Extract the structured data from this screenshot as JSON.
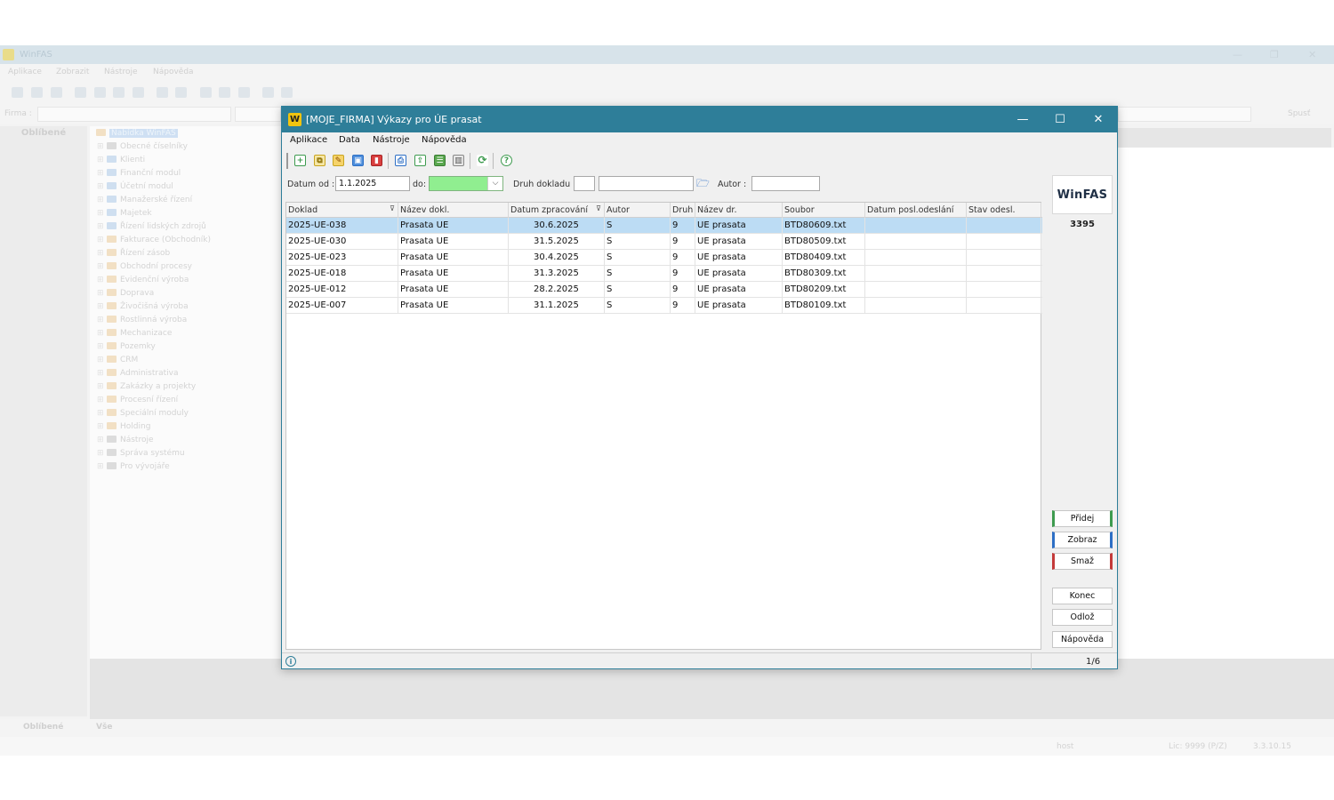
{
  "background_app": {
    "title": "WinFAS",
    "menu": [
      "Aplikace",
      "Zobrazit",
      "Nástroje",
      "Nápověda"
    ],
    "firma_label": "Firma :",
    "spust_label": "Spusť",
    "favorites_header": "Oblíbené",
    "tree_root": "Nabídka WinFAS",
    "tree_items": [
      "Obecné číselníky",
      "Klienti",
      "Finanční modul",
      "Účetní modul",
      "Manažerské řízení",
      "Majetek",
      "Řízení lidských zdrojů",
      "Fakturace (Obchodník)",
      "Řízení zásob",
      "Obchodní procesy",
      "Evidenční výroba",
      "Doprava",
      "Živočišná výroba",
      "Rostlinná výroba",
      "Mechanizace",
      "Pozemky",
      "CRM",
      "Administrativa",
      "Zakázky a projekty",
      "Procesní řízení",
      "Speciální moduly",
      "Holding",
      "Nástroje",
      "Správa systému",
      "Pro vývojáře"
    ],
    "bottom_tabs": [
      "Oblíbené",
      "Vše"
    ],
    "status": {
      "user": "host",
      "license": "Lic: 9999 (P/Z)",
      "version": "3.3.10.15"
    }
  },
  "dialog": {
    "title": "[MOJE_FIRMA] Výkazy pro ÚE prasat",
    "logo_letter": "W",
    "menu": [
      "Aplikace",
      "Data",
      "Nástroje",
      "Nápověda"
    ],
    "filters": {
      "datum_od_label": "Datum od :",
      "datum_od_value": "1.1.2025",
      "do_label": "do:",
      "do_value": "",
      "druh_label": "Druh dokladu :",
      "druh_code": "",
      "druh_name": "",
      "autor_label": "Autor :",
      "autor_value": ""
    },
    "columns": [
      "Doklad",
      "Název dokl.",
      "Datum zpracování",
      "Autor",
      "Druh",
      "Název dr.",
      "Soubor",
      "Datum posl.odeslání",
      "Stav odesl."
    ],
    "rows": [
      [
        "2025-UE-038",
        "Prasata UE",
        "30.6.2025",
        "S",
        "9",
        "UE prasata",
        "BTD80609.txt",
        "",
        ""
      ],
      [
        "2025-UE-030",
        "Prasata UE",
        "31.5.2025",
        "S",
        "9",
        "UE prasata",
        "BTD80509.txt",
        "",
        ""
      ],
      [
        "2025-UE-023",
        "Prasata UE",
        "30.4.2025",
        "S",
        "9",
        "UE prasata",
        "BTD80409.txt",
        "",
        ""
      ],
      [
        "2025-UE-018",
        "Prasata UE",
        "31.3.2025",
        "S",
        "9",
        "UE prasata",
        "BTD80309.txt",
        "",
        ""
      ],
      [
        "2025-UE-012",
        "Prasata UE",
        "28.2.2025",
        "S",
        "9",
        "UE prasata",
        "BTD80209.txt",
        "",
        ""
      ],
      [
        "2025-UE-007",
        "Prasata UE",
        "31.1.2025",
        "S",
        "9",
        "UE prasata",
        "BTD80109.txt",
        "",
        ""
      ]
    ],
    "selected_row": 0,
    "side": {
      "logo": "WinFAS",
      "number": "3395",
      "pridej": "Přidej",
      "zobraz": "Zobraz",
      "smaz": "Smaž",
      "konec": "Konec",
      "odloz": "Odlož",
      "napoveda": "Nápověda"
    },
    "status": {
      "page": "1/6",
      "info_icon": "i"
    }
  },
  "colors": {
    "title_bar": "#2e7e99",
    "selection": "#bcdcf4",
    "date_highlight": "#90ee90"
  }
}
